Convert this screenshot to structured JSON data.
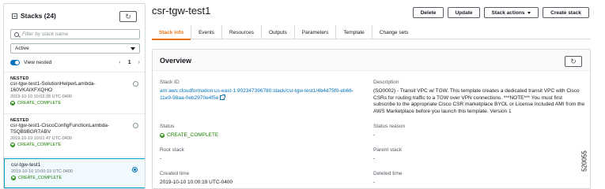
{
  "left_panel": {
    "title": "Stacks (24)",
    "search_placeholder": "Filter by stack name",
    "filter_value": "Active",
    "view_nested_label": "View nested",
    "pager": {
      "prev": "‹",
      "page": "1",
      "next": "›"
    },
    "stacks": [
      {
        "tag": "NESTED",
        "name": "csr-tgw-test1-SolutionHelperLambda-160VKAIXFXQHO",
        "time": "2019-10-10 10:02:28 UTC-0400",
        "status": "CREATE_COMPLETE",
        "selected": false
      },
      {
        "tag": "NESTED",
        "name": "csr-tgw-test1-CiscoConfigFunctionLambda-T5QB9BGR7ABV",
        "time": "2019-10-10 10:01:47 UTC-0400",
        "status": "CREATE_COMPLETE",
        "selected": false
      },
      {
        "tag": "",
        "name": "csr-tgw-test1",
        "time": "2019-10-10 10:00:19 UTC-0400",
        "status": "CREATE_COMPLETE",
        "selected": true
      }
    ]
  },
  "header": {
    "title": "csr-tgw-test1",
    "buttons": {
      "delete": "Delete",
      "update": "Update",
      "stack_actions": "Stack actions",
      "create_stack": "Create stack"
    }
  },
  "tabs": [
    "Stack info",
    "Events",
    "Resources",
    "Outputs",
    "Parameters",
    "Template",
    "Change sets"
  ],
  "overview": {
    "title": "Overview",
    "stack_id": {
      "label": "Stack ID",
      "value_line1": "arn:aws:cloudformation:us-east-1:902347396780:stack/csr-tgw-test1/4b4d75f0-eb66-",
      "value_line2": "11e9-98aa-0eb2970e4f5e"
    },
    "description": {
      "label": "Description",
      "lines": [
        "(SO0002) - Transit VPC w/ TGW. This template creates a dedicated transit VPC with Cisco",
        "CSRs for routing traffic to a TGW over VPN connections. ***NOTE*** You must first",
        "subscribe to the appropriate Cisco CSR marketplace BYOL or License Included AMI from the",
        "AWS Marketplace before you launch this template. Version 1"
      ]
    },
    "status": {
      "label": "Status",
      "value": "CREATE_COMPLETE"
    },
    "status_reason": {
      "label": "Status reason",
      "value": "-"
    },
    "root_stack": {
      "label": "Root stack",
      "value": "-"
    },
    "parent_stack": {
      "label": "Parent stack",
      "value": "-"
    },
    "created_time": {
      "label": "Created time",
      "value": "2019-10-10 10:00:19 UTC-0400"
    },
    "deleted_time": {
      "label": "Deleted time",
      "value": "-"
    }
  },
  "figure_code": "520055",
  "colors": {
    "accent": "#ec7211",
    "link": "#0073bb",
    "success": "#1d8102",
    "selected_border": "#00a1c9"
  },
  "icons": [
    "collapse-icon",
    "refresh-icon",
    "search-icon",
    "dropdown-icon",
    "toggle-icon",
    "success-icon",
    "external-link-icon",
    "radio-icon"
  ]
}
